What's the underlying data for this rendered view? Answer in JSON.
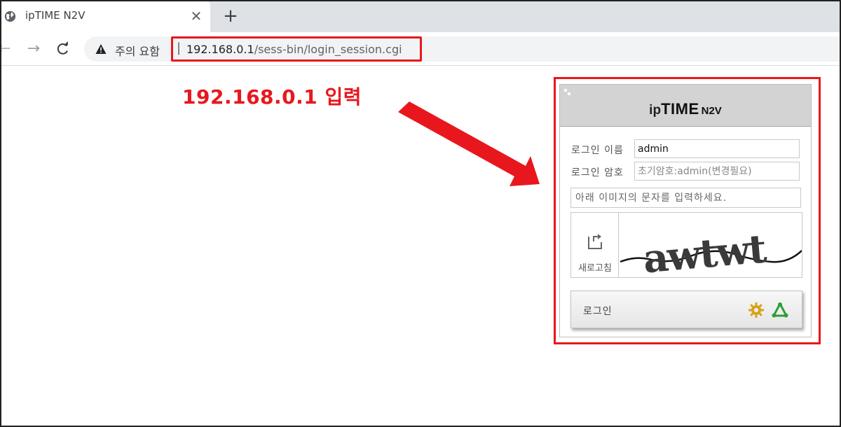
{
  "browser": {
    "tab_title": "ipTIME N2V",
    "tab_close": "✕",
    "new_tab": "+",
    "warning_text": "주의 요함",
    "url_separator": "|",
    "url_host": "192.168.0.1",
    "url_path": "/sess-bin/login_session.cgi"
  },
  "annotation": {
    "text": "192.168.0.1 입력",
    "color": "#e8171d"
  },
  "login_panel": {
    "brand_ip": "ip",
    "brand_time": "TIME",
    "brand_model": "N2V",
    "username_label": "로그인 이름",
    "username_value": "admin",
    "password_label": "로그인 암호",
    "password_placeholder": "초기암호:admin(변경필요)",
    "captcha_placeholder": "아래 이미지의 문자를 입력하세요.",
    "captcha_text": "awtwt",
    "refresh_label": "새로고침",
    "login_label": "로그인"
  },
  "icons": [
    "globe-icon",
    "close-icon",
    "plus-icon",
    "back-arrow-icon",
    "forward-arrow-icon",
    "reload-icon",
    "warning-icon",
    "refresh-icon",
    "gear-icon",
    "network-icon"
  ]
}
